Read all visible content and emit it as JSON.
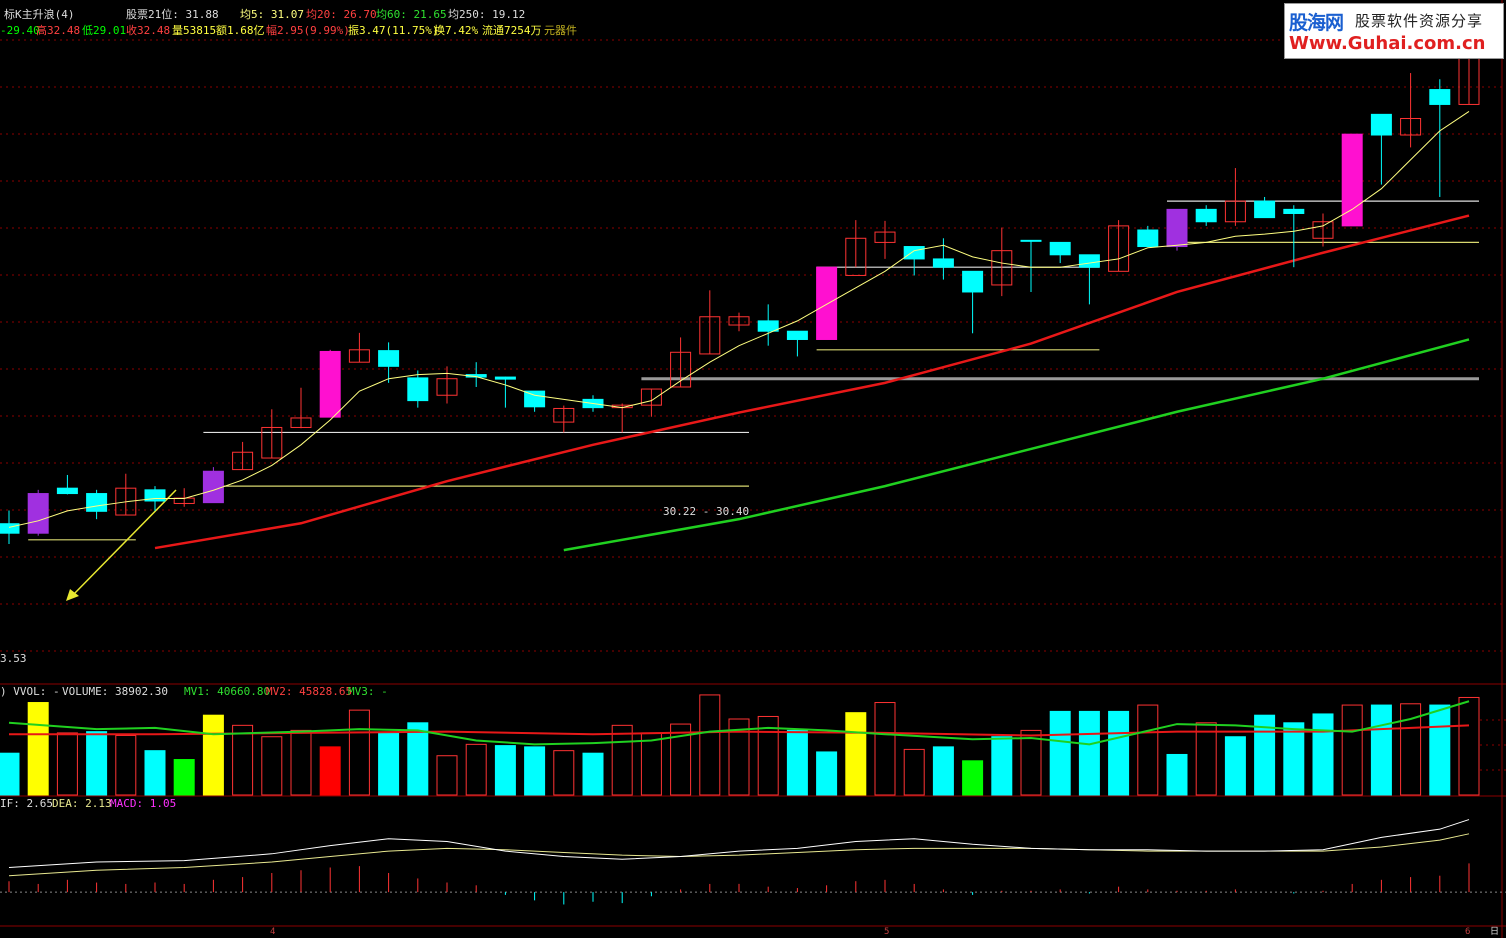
{
  "colors": {
    "up": "#ff3333",
    "down": "#00ffff",
    "ma5": "#ffff80",
    "ma20": "#e81818",
    "ma60": "#20d020",
    "magenta": "#ff10d0",
    "purple": "#a030e0",
    "yellow": "#ffff00",
    "green_bar": "#00ff00",
    "red_bar": "#ff0000",
    "grid": "#8b0000",
    "dif": "#ffffff",
    "dea": "#e8e890"
  },
  "header": {
    "name": "标K主升浪(4)",
    "rank": "股票21位: 31.88",
    "ma5": "均5: 31.07",
    "ma20": "均20: 26.70",
    "ma60": "均60: 21.65",
    "ma250": "均250: 19.12",
    "open": "-29.40",
    "high": "高32.48",
    "low": "低29.01",
    "close": "收32.48",
    "vol": "量53815",
    "amt": "额1.68亿",
    "chg": "幅2.95(9.99%)",
    "amp": "振3.47(11.75%)",
    "turn": "换7.42%",
    "float": "流通7254万",
    "sector": "元器件"
  },
  "annotations": {
    "price_range": "30.22 - 30.40",
    "left_price": "3.53"
  },
  "vol_header": {
    "a": ") VVOL: -",
    "b": "VOLUME: 38902.30",
    "mv1": "MV1: 40660.80",
    "mv2": "MV2: 45828.65",
    "mv3": "MV3: -"
  },
  "macd_header": {
    "dif": "IF: 2.65",
    "dea": "DEA: 2.13",
    "macd": "MACD: 1.05"
  },
  "x_ticks": [
    "4",
    "5",
    "6",
    "日"
  ],
  "watermark": {
    "top": "股海网",
    "right": "股票软件资源分享",
    "url": "Www.Guhai.com.cn"
  },
  "chart_data": {
    "type": "candlestick",
    "y_range": [
      17.5,
      32.8
    ],
    "candles": [
      [
        20.86,
        21.09,
        20.6,
        21.41,
        "d",
        ""
      ],
      [
        20.86,
        21.82,
        20.8,
        21.91,
        "u",
        "purple"
      ],
      [
        21.82,
        21.95,
        21.8,
        22.27,
        "d",
        ""
      ],
      [
        21.82,
        21.39,
        21.2,
        21.91,
        "d",
        ""
      ],
      [
        21.3,
        21.95,
        21.3,
        22.3,
        "u",
        ""
      ],
      [
        21.91,
        21.64,
        21.4,
        22.0,
        "d",
        ""
      ],
      [
        21.58,
        21.71,
        21.5,
        21.95,
        "u",
        ""
      ],
      [
        21.6,
        22.36,
        21.6,
        22.46,
        "u",
        "purple"
      ],
      [
        22.4,
        22.82,
        22.4,
        23.07,
        "u",
        ""
      ],
      [
        22.68,
        23.42,
        22.68,
        23.86,
        "u",
        ""
      ],
      [
        23.42,
        23.65,
        23.4,
        24.38,
        "u",
        ""
      ],
      [
        23.67,
        25.26,
        23.67,
        25.3,
        "u",
        "magenta"
      ],
      [
        25.0,
        25.3,
        25.0,
        25.71,
        "u",
        ""
      ],
      [
        25.28,
        24.9,
        24.5,
        25.48,
        "d",
        ""
      ],
      [
        24.62,
        24.07,
        23.9,
        24.8,
        "d",
        ""
      ],
      [
        24.2,
        24.6,
        24.0,
        24.9,
        "u",
        ""
      ],
      [
        24.7,
        24.64,
        24.4,
        25.0,
        "d",
        ""
      ],
      [
        24.64,
        24.59,
        23.9,
        24.65,
        "d",
        ""
      ],
      [
        24.3,
        23.92,
        23.8,
        24.3,
        "d",
        ""
      ],
      [
        23.55,
        23.88,
        23.3,
        23.95,
        "u",
        ""
      ],
      [
        24.1,
        23.9,
        23.8,
        24.2,
        "d",
        ""
      ],
      [
        23.9,
        23.96,
        23.3,
        24.0,
        "u",
        ""
      ],
      [
        23.96,
        24.35,
        23.68,
        24.35,
        "u",
        ""
      ],
      [
        24.4,
        25.24,
        24.4,
        25.6,
        "u",
        ""
      ],
      [
        25.2,
        26.1,
        25.2,
        26.74,
        "u",
        ""
      ],
      [
        25.9,
        26.1,
        25.75,
        26.2,
        "u",
        ""
      ],
      [
        26.0,
        25.75,
        25.4,
        26.4,
        "d",
        ""
      ],
      [
        25.75,
        25.55,
        25.14,
        25.75,
        "d",
        ""
      ],
      [
        25.55,
        27.3,
        25.55,
        27.3,
        "u",
        "magenta"
      ],
      [
        27.1,
        28.0,
        27.3,
        28.44,
        "u",
        ""
      ],
      [
        27.9,
        28.15,
        27.5,
        28.42,
        "u",
        ""
      ],
      [
        27.8,
        27.5,
        27.1,
        27.8,
        "d",
        ""
      ],
      [
        27.5,
        27.3,
        27.0,
        28.0,
        "d",
        ""
      ],
      [
        27.2,
        26.7,
        25.7,
        27.2,
        "d",
        ""
      ],
      [
        26.87,
        27.7,
        26.6,
        28.26,
        "u",
        ""
      ],
      [
        27.95,
        27.95,
        26.7,
        27.95,
        "d",
        ""
      ],
      [
        27.9,
        27.6,
        27.4,
        27.9,
        "d",
        ""
      ],
      [
        27.6,
        27.3,
        26.4,
        27.6,
        "d",
        ""
      ],
      [
        27.2,
        28.3,
        27.2,
        28.44,
        "u",
        ""
      ],
      [
        28.2,
        27.8,
        27.8,
        28.3,
        "d",
        ""
      ],
      [
        28.7,
        27.8,
        27.7,
        28.7,
        "d",
        "purple"
      ],
      [
        28.7,
        28.4,
        28.3,
        28.8,
        "d",
        ""
      ],
      [
        28.4,
        28.9,
        28.3,
        29.7,
        "u",
        ""
      ],
      [
        28.9,
        28.5,
        28.5,
        29.0,
        "d",
        ""
      ],
      [
        28.6,
        28.7,
        27.3,
        28.8,
        "d",
        ""
      ],
      [
        28.0,
        28.4,
        27.8,
        28.6,
        "u",
        ""
      ],
      [
        28.3,
        30.52,
        28.3,
        30.52,
        "u",
        "magenta"
      ],
      [
        31.0,
        30.5,
        29.3,
        31.0,
        "d",
        ""
      ],
      [
        30.5,
        30.9,
        30.2,
        32.0,
        "u",
        ""
      ],
      [
        31.6,
        31.24,
        29.0,
        31.85,
        "d",
        ""
      ],
      [
        31.24,
        32.48,
        31.24,
        32.48,
        "u",
        ""
      ]
    ],
    "ma5": [
      [
        0,
        21.0
      ],
      [
        1,
        21.16
      ],
      [
        2,
        21.4
      ],
      [
        3,
        21.52
      ],
      [
        4,
        21.62
      ],
      [
        5,
        21.7
      ],
      [
        6,
        21.7
      ],
      [
        7,
        21.9
      ],
      [
        8,
        22.15
      ],
      [
        9,
        22.5
      ],
      [
        10,
        23.0
      ],
      [
        11,
        23.6
      ],
      [
        12,
        24.3
      ],
      [
        13,
        24.6
      ],
      [
        14,
        24.7
      ],
      [
        15,
        24.73
      ],
      [
        16,
        24.65
      ],
      [
        17,
        24.45
      ],
      [
        18,
        24.2
      ],
      [
        19,
        24.1
      ],
      [
        20,
        24.0
      ],
      [
        21,
        23.9
      ],
      [
        22,
        24.07
      ],
      [
        23,
        24.55
      ],
      [
        24,
        25.0
      ],
      [
        25,
        25.4
      ],
      [
        26,
        25.7
      ],
      [
        27,
        26.0
      ],
      [
        28,
        26.4
      ],
      [
        29,
        26.8
      ],
      [
        30,
        27.2
      ],
      [
        31,
        27.7
      ],
      [
        32,
        27.83
      ],
      [
        33,
        27.55
      ],
      [
        34,
        27.4
      ],
      [
        35,
        27.3
      ],
      [
        36,
        27.3
      ],
      [
        37,
        27.4
      ],
      [
        38,
        27.5
      ],
      [
        39,
        27.77
      ],
      [
        40,
        27.83
      ],
      [
        41,
        27.9
      ],
      [
        42,
        28.05
      ],
      [
        43,
        28.1
      ],
      [
        44,
        28.17
      ],
      [
        45,
        28.3
      ],
      [
        46,
        28.7
      ],
      [
        47,
        29.2
      ],
      [
        48,
        29.9
      ],
      [
        49,
        30.6
      ],
      [
        50,
        31.07
      ]
    ],
    "ma20": [
      [
        5,
        20.5
      ],
      [
        10,
        21.1
      ],
      [
        15,
        22.12
      ],
      [
        20,
        23.0
      ],
      [
        25,
        23.78
      ],
      [
        30,
        24.5
      ],
      [
        35,
        25.45
      ],
      [
        40,
        26.7
      ],
      [
        45,
        27.65
      ],
      [
        50,
        28.55
      ]
    ],
    "ma60": [
      [
        19,
        20.45
      ],
      [
        25,
        21.2
      ],
      [
        30,
        22.0
      ],
      [
        35,
        22.9
      ],
      [
        40,
        23.8
      ],
      [
        45,
        24.6
      ],
      [
        50,
        25.55
      ]
    ],
    "flat_lines": [
      {
        "from": 1,
        "to": 4,
        "value": 20.7,
        "color": "yellow"
      },
      {
        "from": 7,
        "to": 25,
        "value": 23.3,
        "color": "white"
      },
      {
        "from": 7,
        "to": 25,
        "value": 22.0,
        "color": "yellow"
      },
      {
        "from": 22,
        "to": 50,
        "value": 24.6,
        "color": "gray"
      },
      {
        "from": 28,
        "to": 37,
        "value": 27.3,
        "color": "white"
      },
      {
        "from": 28,
        "to": 37,
        "value": 25.3,
        "color": "yellow"
      },
      {
        "from": 40,
        "to": 50,
        "value": 28.9,
        "color": "white"
      },
      {
        "from": 40,
        "to": 50,
        "value": 27.9,
        "color": "yellow"
      }
    ],
    "volume": {
      "y_range": [
        0,
        75000
      ],
      "bars": [
        [
          33000,
          "d",
          ""
        ],
        [
          73000,
          "u",
          "yellow"
        ],
        [
          49000,
          "u",
          ""
        ],
        [
          50000,
          "d",
          ""
        ],
        [
          47000,
          "u",
          ""
        ],
        [
          35000,
          "d",
          ""
        ],
        [
          28000,
          "d",
          "green"
        ],
        [
          63000,
          "u",
          "yellow"
        ],
        [
          55000,
          "u",
          ""
        ],
        [
          46000,
          "u",
          ""
        ],
        [
          51000,
          "u",
          ""
        ],
        [
          38000,
          "u",
          "red"
        ],
        [
          67000,
          "u",
          ""
        ],
        [
          49000,
          "d",
          ""
        ],
        [
          57000,
          "d",
          ""
        ],
        [
          31000,
          "u",
          ""
        ],
        [
          40000,
          "u",
          ""
        ],
        [
          39000,
          "d",
          ""
        ],
        [
          38000,
          "d",
          ""
        ],
        [
          35000,
          "u",
          ""
        ],
        [
          33000,
          "d",
          ""
        ],
        [
          55000,
          "u",
          ""
        ],
        [
          49000,
          "u",
          ""
        ],
        [
          56000,
          "u",
          ""
        ],
        [
          79000,
          "u",
          ""
        ],
        [
          60000,
          "u",
          ""
        ],
        [
          62000,
          "u",
          ""
        ],
        [
          51000,
          "d",
          ""
        ],
        [
          34000,
          "d",
          ""
        ],
        [
          65000,
          "u",
          "yellow"
        ],
        [
          73000,
          "u",
          ""
        ],
        [
          36000,
          "u",
          ""
        ],
        [
          38000,
          "d",
          ""
        ],
        [
          27000,
          "d",
          "green"
        ],
        [
          46000,
          "d",
          ""
        ],
        [
          51000,
          "u",
          ""
        ],
        [
          66000,
          "d",
          ""
        ],
        [
          66000,
          "d",
          ""
        ],
        [
          66000,
          "d",
          ""
        ],
        [
          71000,
          "u",
          ""
        ],
        [
          32000,
          "d",
          ""
        ],
        [
          57000,
          "u",
          ""
        ],
        [
          46000,
          "d",
          ""
        ],
        [
          63000,
          "d",
          ""
        ],
        [
          57000,
          "d",
          ""
        ],
        [
          64000,
          "d",
          ""
        ],
        [
          71000,
          "u",
          ""
        ],
        [
          71000,
          "d",
          ""
        ],
        [
          72000,
          "u",
          ""
        ],
        [
          71000,
          "d",
          ""
        ],
        [
          77000,
          "u",
          ""
        ]
      ],
      "mv1": [
        [
          0,
          57000
        ],
        [
          3,
          52000
        ],
        [
          5,
          53000
        ],
        [
          7,
          48000
        ],
        [
          10,
          50000
        ],
        [
          12,
          52000
        ],
        [
          14,
          51000
        ],
        [
          16,
          43000
        ],
        [
          18,
          40000
        ],
        [
          20,
          41000
        ],
        [
          22,
          43000
        ],
        [
          24,
          50000
        ],
        [
          26,
          53000
        ],
        [
          28,
          51000
        ],
        [
          30,
          48000
        ],
        [
          33,
          44000
        ],
        [
          35,
          45000
        ],
        [
          37,
          40000
        ],
        [
          40,
          56000
        ],
        [
          42,
          55000
        ],
        [
          44,
          52000
        ],
        [
          46,
          50000
        ],
        [
          48,
          60000
        ],
        [
          50,
          74000
        ]
      ],
      "mv2": [
        [
          0,
          48000
        ],
        [
          5,
          48000
        ],
        [
          10,
          49000
        ],
        [
          15,
          50000
        ],
        [
          20,
          48000
        ],
        [
          25,
          50000
        ],
        [
          30,
          49000
        ],
        [
          35,
          47000
        ],
        [
          40,
          50000
        ],
        [
          45,
          50000
        ],
        [
          50,
          55000
        ]
      ]
    },
    "macd": {
      "y_range": [
        -1.2,
        3.0
      ],
      "dif": [
        [
          0,
          0.9
        ],
        [
          3,
          1.1
        ],
        [
          6,
          1.15
        ],
        [
          9,
          1.4
        ],
        [
          11,
          1.7
        ],
        [
          13,
          1.95
        ],
        [
          15,
          1.85
        ],
        [
          17,
          1.5
        ],
        [
          19,
          1.3
        ],
        [
          21,
          1.2
        ],
        [
          23,
          1.3
        ],
        [
          25,
          1.5
        ],
        [
          27,
          1.6
        ],
        [
          29,
          1.85
        ],
        [
          31,
          1.95
        ],
        [
          33,
          1.75
        ],
        [
          35,
          1.6
        ],
        [
          37,
          1.55
        ],
        [
          39,
          1.55
        ],
        [
          41,
          1.5
        ],
        [
          43,
          1.5
        ],
        [
          45,
          1.55
        ],
        [
          47,
          2.0
        ],
        [
          49,
          2.3
        ],
        [
          50,
          2.65
        ]
      ],
      "dea": [
        [
          0,
          0.6
        ],
        [
          3,
          0.8
        ],
        [
          6,
          0.9
        ],
        [
          9,
          1.1
        ],
        [
          11,
          1.3
        ],
        [
          13,
          1.5
        ],
        [
          15,
          1.6
        ],
        [
          17,
          1.55
        ],
        [
          19,
          1.45
        ],
        [
          21,
          1.35
        ],
        [
          23,
          1.3
        ],
        [
          25,
          1.35
        ],
        [
          27,
          1.45
        ],
        [
          29,
          1.55
        ],
        [
          31,
          1.6
        ],
        [
          33,
          1.6
        ],
        [
          35,
          1.6
        ],
        [
          37,
          1.55
        ],
        [
          39,
          1.5
        ],
        [
          41,
          1.5
        ],
        [
          43,
          1.5
        ],
        [
          45,
          1.5
        ],
        [
          47,
          1.65
        ],
        [
          49,
          1.9
        ],
        [
          50,
          2.13
        ]
      ],
      "bars": [
        0.4,
        0.3,
        0.45,
        0.35,
        0.3,
        0.35,
        0.3,
        0.45,
        0.55,
        0.7,
        0.8,
        0.9,
        0.95,
        0.7,
        0.5,
        0.35,
        0.25,
        -0.1,
        -0.3,
        -0.45,
        -0.35,
        -0.4,
        -0.15,
        0.1,
        0.3,
        0.3,
        0.2,
        0.15,
        0.25,
        0.4,
        0.45,
        0.3,
        0.1,
        -0.1,
        0.05,
        0.05,
        0.1,
        -0.05,
        0.2,
        0.1,
        0.05,
        0.05,
        0.1,
        0.0,
        -0.05,
        0.05,
        0.3,
        0.45,
        0.55,
        0.6,
        1.05
      ]
    }
  }
}
